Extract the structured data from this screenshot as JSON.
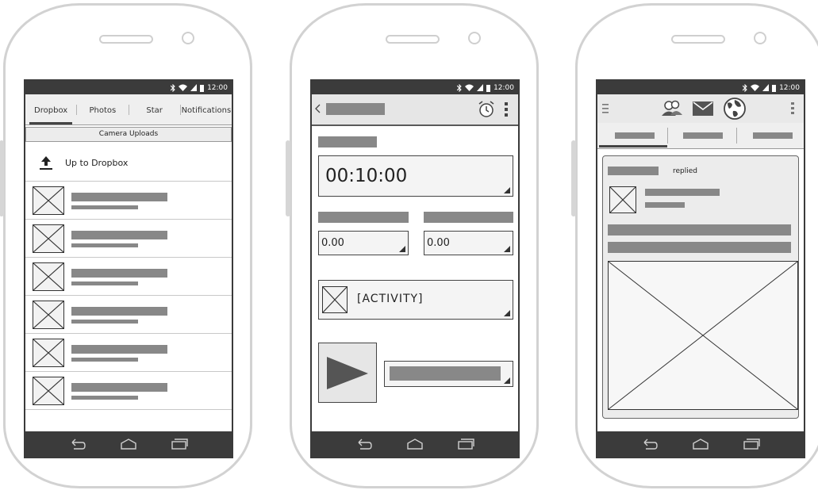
{
  "status": {
    "time": "12:00"
  },
  "phone1": {
    "tabs": [
      "Dropbox",
      "Photos",
      "Star",
      "Notifications"
    ],
    "active_tab": "Dropbox",
    "folder_title": "Camera Uploads",
    "up_label": "Up to Dropbox",
    "list_item_count": 6
  },
  "phone2": {
    "timer_value": "00:10:00",
    "value_left": "0.00",
    "value_right": "0.00",
    "activity_label": "[ACTIVITY]"
  },
  "phone3": {
    "replied_label": "replied"
  },
  "icons": {
    "back": "back-arrow-icon",
    "home": "home-icon",
    "recents": "recents-icon",
    "alarm": "alarm-clock-icon",
    "overflow": "overflow-menu-icon",
    "people": "people-icon",
    "mail": "mail-icon",
    "globe": "globe-icon",
    "hamburger": "hamburger-menu-icon",
    "upload": "upload-arrow-icon",
    "play": "play-icon"
  },
  "colors": {
    "frame": "#d2d2d2",
    "bars": "#3b3b3b",
    "placeholder": "#888888"
  }
}
